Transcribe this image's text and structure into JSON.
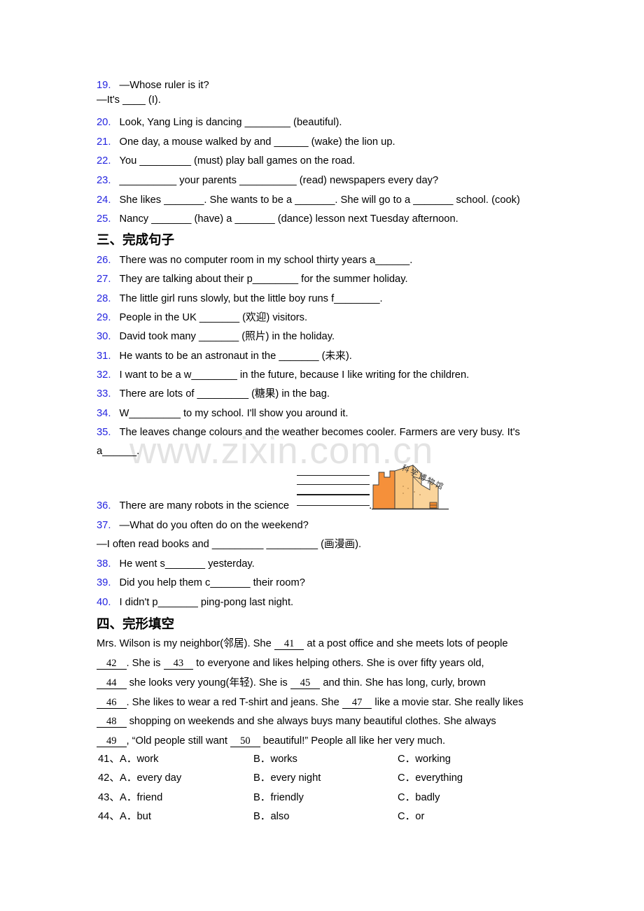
{
  "document": {
    "watermark": "www.zixin.com.cn"
  },
  "questions": [
    {
      "num": "19.",
      "text": "—Whose ruler is it?",
      "cont": "—It's ____ (I)."
    },
    {
      "num": "20.",
      "text": "Look, Yang Ling is dancing ________ (beautiful)."
    },
    {
      "num": "21.",
      "text": "One day, a mouse walked by and ______ (wake) the lion up."
    },
    {
      "num": "22.",
      "text": "You _________ (must) play ball games on the road."
    },
    {
      "num": "23.",
      "text": "__________ your parents __________ (read) newspapers every day?"
    },
    {
      "num": "24.",
      "text": "She likes _______. She wants to be a _______. She will go to a _______ school. (cook)"
    },
    {
      "num": "25.",
      "text": "Nancy _______ (have) a _______ (dance) lesson next Tuesday afternoon."
    }
  ],
  "section3": {
    "heading": "三、完成句子",
    "questions": [
      {
        "num": "26.",
        "text": "There was no computer room in my school thirty years a______."
      },
      {
        "num": "27.",
        "text": "They are talking about their p________ for the summer holiday."
      },
      {
        "num": "28.",
        "text": "The little girl runs slowly, but the little boy runs f________."
      },
      {
        "num": "29.",
        "text": "People in the UK _______ (欢迎) visitors."
      },
      {
        "num": "30.",
        "text": "David took many _______ (照片) in the holiday."
      },
      {
        "num": "31.",
        "text": "He wants to be an astronaut in the _______ (未来)."
      },
      {
        "num": "32.",
        "text": "I want to be a w________ in the future, because I like writing for the children."
      },
      {
        "num": "33.",
        "text": "There are lots of _________ (糖果) in the bag."
      },
      {
        "num": "34.",
        "text": "W_________ to my school. I'll show you around it."
      },
      {
        "num": "35.",
        "text": "The leaves change colours and the weather becomes cooler. Farmers are very busy. It's",
        "cont": "a______."
      },
      {
        "num": "36.",
        "text": "There are many robots in the science",
        "tail": "."
      },
      {
        "num": "37.",
        "text": "—What do you often do on the weekend?",
        "cont": "—I often read books and _________ _________ (画漫画)."
      },
      {
        "num": "38.",
        "text": "He went s_______ yesterday."
      },
      {
        "num": "39.",
        "text": "Did you help them c_______ their room?"
      },
      {
        "num": "40.",
        "text": "I didn't p_______ ping-pong last night."
      }
    ],
    "illustration_label": "科学博物馆"
  },
  "section4": {
    "heading": "四、完形填空",
    "passage": [
      {
        "pre": "Mrs. Wilson is my neighbor(邻居). She ",
        "blank": "41",
        "post": " at a post office and she meets lots of people"
      },
      {
        "pre": "",
        "blank": "42",
        "post": ". She is ",
        "blank2": "43",
        "post2": " to everyone and likes helping others. She is over fifty years old,"
      },
      {
        "pre": "",
        "blank": "44",
        "post": " she looks very young(年轻). She is ",
        "blank2": "45",
        "post2": " and thin. She has long, curly, brown"
      },
      {
        "pre": "",
        "blank": "46",
        "post": ". She likes to wear a red T-shirt and jeans. She ",
        "blank2": "47",
        "post2": " like a movie star. She really likes"
      },
      {
        "pre": "",
        "blank": "48",
        "post": " shopping on weekends and she always buys many beautiful clothes. She always"
      },
      {
        "pre": "",
        "blank": "49",
        "post": ", “Old people still want ",
        "blank2": "50",
        "post2": " beautiful!” People all like her very much."
      }
    ],
    "choices": [
      {
        "num": "41、",
        "a": "A．work",
        "b": "B．works",
        "c": "C．working"
      },
      {
        "num": "42、",
        "a": "A．every day",
        "b": "B．every night",
        "c": "C．everything"
      },
      {
        "num": "43、",
        "a": "A．friend",
        "b": "B．friendly",
        "c": "C．badly"
      },
      {
        "num": "44、",
        "a": "A．but",
        "b": "B．also",
        "c": "C．or"
      }
    ]
  }
}
